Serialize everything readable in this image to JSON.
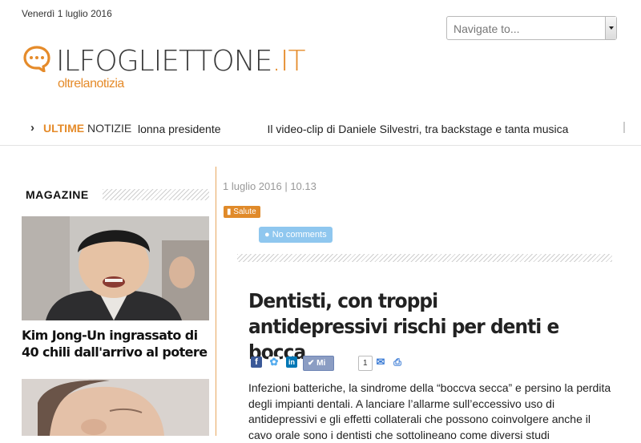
{
  "header": {
    "date": "Venerdì 1 luglio 2016",
    "navigate_placeholder": "Navigate to...",
    "logo_main": "ILFOGLIETTONE",
    "logo_tld": ".IT",
    "logo_tagline": "oltrelanotizia"
  },
  "ticker": {
    "label_strong": "ULTIME",
    "label_rest": "NOTIZIE",
    "items": [
      "lonna presidente",
      "Il video-clip di Daniele Silvestri, tra backstage e tanta musica"
    ]
  },
  "sidebar": {
    "title": "MAGAZINE",
    "articles": [
      {
        "title": "Kim Jong-Un ingrassato di 40 chili dall'arrivo al potere"
      }
    ]
  },
  "article": {
    "date": "1 luglio 2016 | 10.13",
    "category": "Salute",
    "comments": "No comments",
    "title": "Dentisti, con troppi antidepressivi rischi per denti e bocca",
    "like_label": "Mi piace",
    "like_count": "1",
    "body": "Infezioni batteriche, la sindrome della “boccva secca” e persino la perdita degli impianti dentali. A lanciare l’allarme sull’eccessivo uso di antidepressivi e gli effetti collaterali che possono coinvolgere anche il cavo orale sono i dentisti che sottolineano come diversi studi"
  },
  "colors": {
    "accent": "#e58b2a",
    "comments_badge": "#8fc7ef",
    "facebook": "#3b5998",
    "twitter": "#55acee",
    "linkedin": "#0077b5"
  },
  "icons": [
    "chat-bubble-logo-icon",
    "chevron-right-icon",
    "folder-icon",
    "comment-icon",
    "facebook-icon",
    "twitter-icon",
    "linkedin-icon",
    "checkmark-icon",
    "email-icon",
    "print-icon"
  ]
}
